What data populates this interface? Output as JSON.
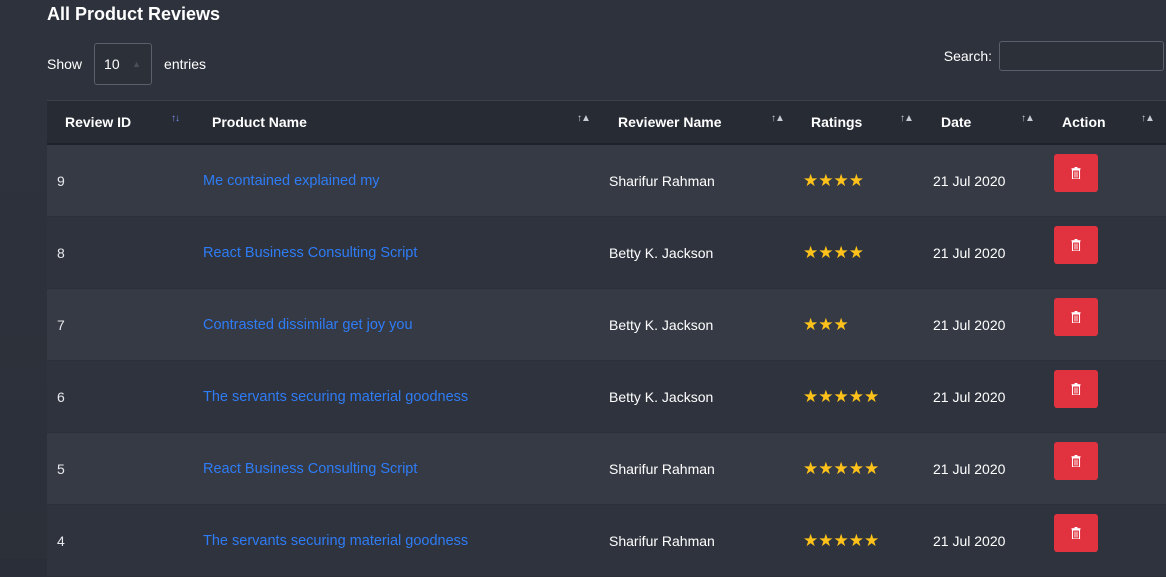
{
  "page": {
    "title": "All Product Reviews"
  },
  "controls": {
    "show_label": "Show",
    "length_value": "10",
    "entries_label": "entries",
    "search_label": "Search:",
    "search_value": ""
  },
  "table": {
    "columns": [
      {
        "label": "Review ID",
        "sort_icon": "sort-desc-active-icon"
      },
      {
        "label": "Product Name",
        "sort_icon": "sort-both-icon"
      },
      {
        "label": "Reviewer Name",
        "sort_icon": "sort-both-icon"
      },
      {
        "label": "Ratings",
        "sort_icon": "sort-both-icon"
      },
      {
        "label": "Date",
        "sort_icon": "sort-both-icon"
      },
      {
        "label": "Action",
        "sort_icon": "sort-both-icon"
      }
    ],
    "rows": [
      {
        "id": "9",
        "product": "Me contained explained my",
        "reviewer": "Sharifur Rahman",
        "rating": 4,
        "date": "21 Jul 2020",
        "action_icon": "trash-icon"
      },
      {
        "id": "8",
        "product": "React Business Consulting Script",
        "reviewer": "Betty K. Jackson",
        "rating": 4,
        "date": "21 Jul 2020",
        "action_icon": "trash-icon"
      },
      {
        "id": "7",
        "product": "Contrasted dissimilar get joy you",
        "reviewer": "Betty K. Jackson",
        "rating": 3,
        "date": "21 Jul 2020",
        "action_icon": "trash-icon"
      },
      {
        "id": "6",
        "product": "The servants securing material goodness",
        "reviewer": "Betty K. Jackson",
        "rating": 5,
        "date": "21 Jul 2020",
        "action_icon": "trash-icon"
      },
      {
        "id": "5",
        "product": "React Business Consulting Script",
        "reviewer": "Sharifur Rahman",
        "rating": 5,
        "date": "21 Jul 2020",
        "action_icon": "trash-icon"
      },
      {
        "id": "4",
        "product": "The servants securing material goodness",
        "reviewer": "Sharifur Rahman",
        "rating": 5,
        "date": "21 Jul 2020",
        "action_icon": "trash-icon"
      }
    ]
  },
  "colors": {
    "background": "#2c3039",
    "link": "#2e7cf6",
    "star": "#ffc21a",
    "danger": "#e0323f"
  }
}
